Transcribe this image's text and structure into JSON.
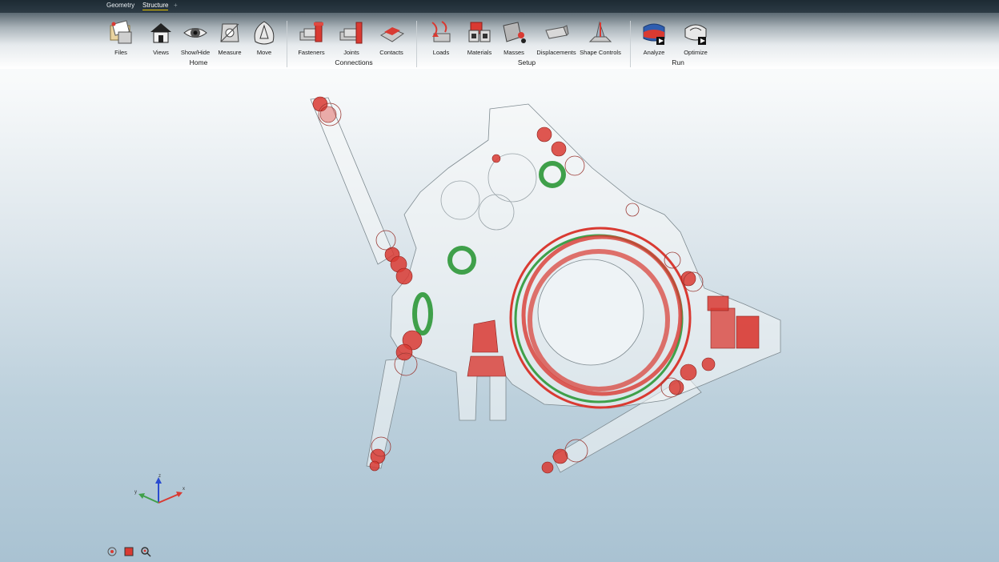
{
  "top_tabs": [
    {
      "label": "Geometry",
      "active": false
    },
    {
      "label": "Structure",
      "active": true
    },
    {
      "label": "+",
      "active": false
    }
  ],
  "ribbon": {
    "groups": [
      {
        "name": "Home",
        "tools": [
          "Files",
          "Views",
          "Show/Hide",
          "Measure",
          "Move"
        ]
      },
      {
        "name": "Connections",
        "tools": [
          "Fasteners",
          "Joints",
          "Contacts"
        ]
      },
      {
        "name": "Setup",
        "tools": [
          "Loads",
          "Materials",
          "Masses",
          "Displacements",
          "Shape Controls"
        ]
      },
      {
        "name": "Run",
        "tools": [
          "Analyze",
          "Optimize"
        ]
      }
    ]
  },
  "icons": {
    "files": "files-icon",
    "views": "house-view-icon",
    "showhide": "eye-icon",
    "measure": "measure-icon",
    "move": "move-icon",
    "fasteners": "fastener-bolt-icon",
    "joints": "joint-pin-icon",
    "contacts": "contact-plates-icon",
    "loads": "load-arrow-icon",
    "materials": "material-blocks-icon",
    "masses": "mass-icon",
    "displacements": "displacement-icon",
    "shape_controls": "shape-control-icon",
    "analyze": "analyze-run-icon",
    "optimize": "optimize-run-icon",
    "triad": "xyz-axis-triad-icon",
    "bottom_tools": [
      "snap-icon",
      "select-box-icon",
      "zoom-icon"
    ]
  },
  "colors": {
    "accent_red": "#d93a32",
    "accent_green": "#3fa04a",
    "active_tab_underline": "#e6c200"
  }
}
